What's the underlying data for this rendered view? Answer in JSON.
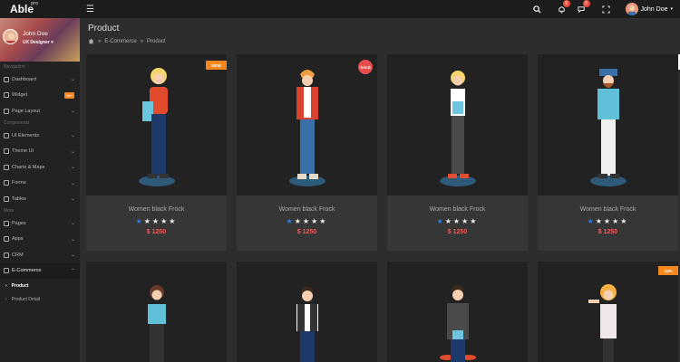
{
  "topbar": {
    "logo": "Able",
    "logo_sup": "pro",
    "notif1": "9",
    "notif2": "5",
    "user_name": "John Doe"
  },
  "sidebar": {
    "profile": {
      "name": "John Doe",
      "role": "UX Designer"
    },
    "sections": {
      "navigation": "Navigation",
      "components": "Components",
      "more": "More"
    },
    "items": {
      "dashboard": "Dashboard",
      "widget": "Widget",
      "widget_badge": "50+",
      "page_layout": "Page Layout",
      "ui_elements": "UI Elements",
      "theme_ui": "Theme UI",
      "charts_maps": "Charts & Maps",
      "forms": "Forms",
      "tables": "Tables",
      "pages": "Pages",
      "apps": "Apps",
      "crm": "CRM",
      "ecommerce": "E-Commerce",
      "product": "Product",
      "product_detail": "Product Detail"
    }
  },
  "page": {
    "title": "Product",
    "breadcrumb": [
      "E-Commerce",
      "Product"
    ]
  },
  "products": [
    {
      "name": "Women black Frock",
      "price": "$ 1250",
      "rating": 1,
      "tag": "NEW",
      "stars": "★★★★★"
    },
    {
      "name": "Women black Frock",
      "price": "$ 1250",
      "rating": 1,
      "tag": "SALE",
      "stars": "★★★★★"
    },
    {
      "name": "Women black Frock",
      "price": "$ 1250",
      "rating": 1,
      "tag": "",
      "stars": "★★★★★"
    },
    {
      "name": "Women black Frock",
      "price": "$ 1250",
      "rating": 1,
      "tag": "",
      "stars": "★★★★★"
    },
    {
      "tag": ""
    },
    {
      "tag": ""
    },
    {
      "tag": ""
    },
    {
      "tag": "15%"
    }
  ],
  "colors": {
    "accent": "#f5871f",
    "price": "#f25c5c",
    "star": "#2c7be5"
  }
}
